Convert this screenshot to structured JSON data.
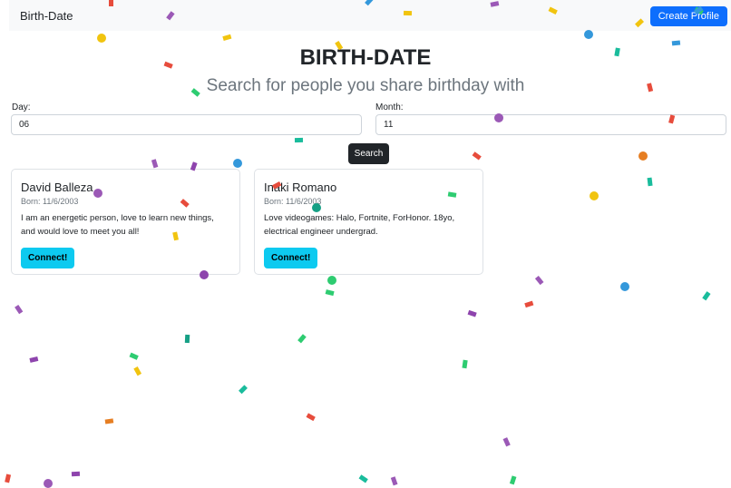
{
  "navbar": {
    "brand": "Birth-Date",
    "create_profile_label": "Create Profile"
  },
  "page": {
    "title": "BIRTH-DATE",
    "subtitle": "Search for people you share birthday with"
  },
  "search": {
    "day_label": "Day:",
    "day_value": "06",
    "month_label": "Month:",
    "month_value": "11",
    "button_label": "Search"
  },
  "results": [
    {
      "name": "David Balleza",
      "born": "Born: 11/6/2003",
      "bio": "I am an energetic person, love to learn new things, and would love to meet you all!",
      "button_label": "Connect!"
    },
    {
      "name": "Inaki Romano",
      "born": "Born: 11/6/2003",
      "bio": "Love videogames: Halo, Fortnite, ForHonor. 18yo, electrical engineer undergrad.",
      "button_label": "Connect!"
    }
  ],
  "colors": {
    "primary": "#0d6efd",
    "info": "#0dcaf0",
    "dark": "#212529",
    "muted": "#6c757d",
    "confetti": [
      "#e74c3c",
      "#3498db",
      "#f1c40f",
      "#2ecc71",
      "#9b59b6",
      "#1abc9c",
      "#e67e22",
      "#8e44ad",
      "#16a085"
    ]
  }
}
